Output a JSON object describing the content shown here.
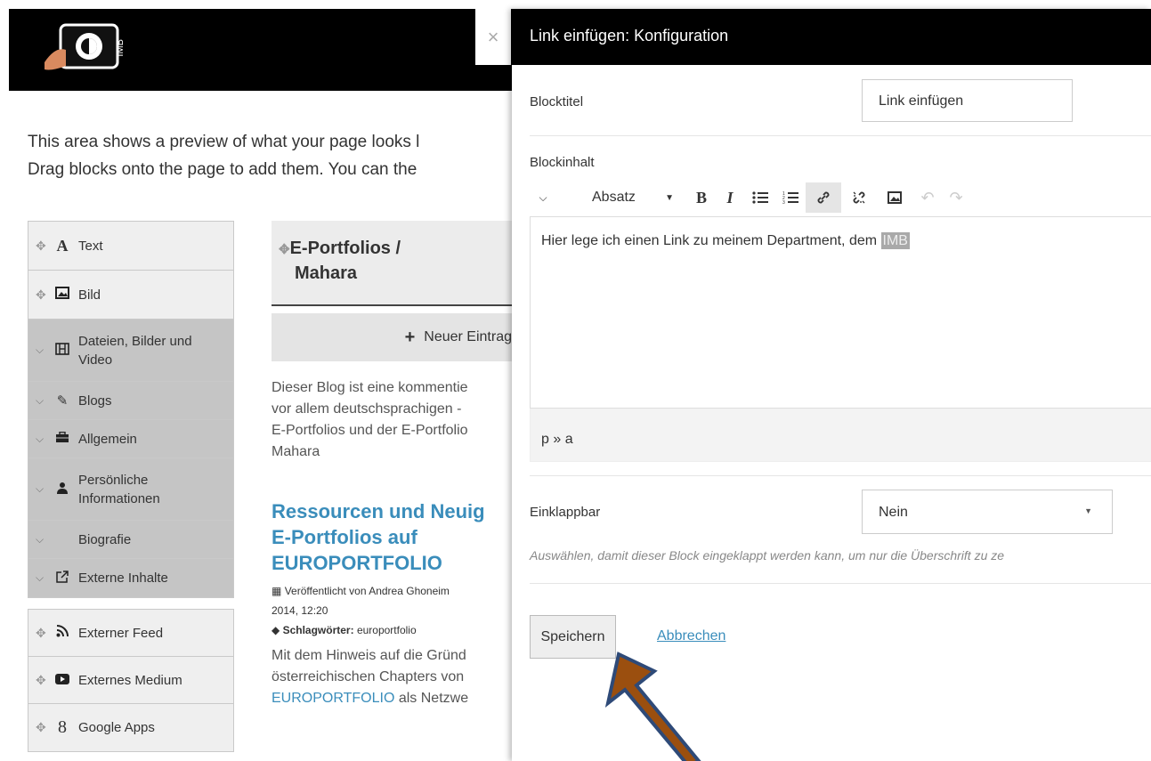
{
  "header": {
    "logo_text": "IMB",
    "close_glyph": "×"
  },
  "intro": {
    "line1": "This area shows a preview of what your page looks l",
    "line2": "Drag blocks onto the page to add them. You can the"
  },
  "palette": {
    "items": [
      {
        "label": "Text",
        "icon": "text-icon"
      },
      {
        "label": "Bild",
        "icon": "image-icon"
      },
      {
        "label_line1": "Dateien, Bilder und",
        "label_line2": "Video",
        "icon": "film-icon"
      },
      {
        "label": "Blogs",
        "icon": "pencil-icon"
      },
      {
        "label": "Allgemein",
        "icon": "briefcase-icon"
      },
      {
        "label_line1": "Persönliche",
        "label_line2": "Informationen",
        "icon": "user-icon"
      },
      {
        "label": "Biografie"
      },
      {
        "label": "Externe Inhalte",
        "icon": "external-link-icon"
      },
      {
        "label": "Externer Feed",
        "icon": "rss-icon"
      },
      {
        "label": "Externes Medium",
        "icon": "youtube-icon"
      },
      {
        "label": "Google Apps",
        "icon": "google-icon"
      }
    ]
  },
  "blog": {
    "title_line1": "E-Portfolios /",
    "title_line2": "Mahara",
    "new_entry": "Neuer Eintrag",
    "desc_lines": [
      "Dieser Blog ist eine kommentie",
      "vor allem deutschsprachigen -",
      "E-Portfolios und der E-Portfolio",
      "Mahara"
    ],
    "post_title_lines": [
      "Ressourcen und Neuig",
      "E-Portfolios auf",
      "EUROPORTFOLIO"
    ],
    "post_meta_line1": "Veröffentlicht von Andrea Ghoneim",
    "post_meta_line2": "2014, 12:20",
    "post_tags_label": "Schlagwörter:",
    "post_tags_value": "europortfolio",
    "body_lines": [
      "Mit dem Hinweis auf die Gründ",
      "österreichischen Chapters von"
    ],
    "body_link": "EUROPORTFOLIO",
    "body_link_rest": " als Netzwe"
  },
  "panel": {
    "title": "Link einfügen: Konfiguration",
    "blocktitle_label": "Blocktitel",
    "blocktitle_value": "Link einfügen",
    "blockinhalt_label": "Blockinhalt",
    "format_select": "Absatz",
    "editor_text": "Hier lege ich einen Link zu meinem Department, dem ",
    "editor_selected": "IMB",
    "statusbar_path": "p » a",
    "einklappbar_label": "Einklappbar",
    "einklappbar_value": "Nein",
    "help_text": "Auswählen, damit dieser Block eingeklappt werden kann, um nur die Überschrift zu ze",
    "save_label": "Speichern",
    "cancel_label": "Abbrechen"
  },
  "colors": {
    "accent": "#3a8dbb",
    "arrow_fill": "#9b4f0f",
    "arrow_stroke": "#2e4a78"
  }
}
